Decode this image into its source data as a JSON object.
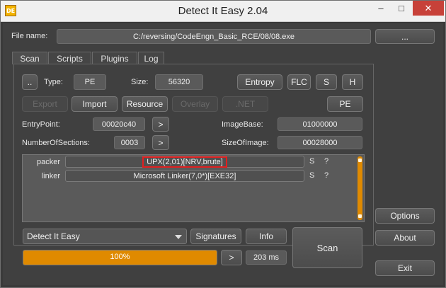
{
  "window": {
    "title": "Detect It Easy 2.04",
    "icon_text": "DE",
    "minimize": "–",
    "maximize": "□",
    "close": "✕"
  },
  "file": {
    "label": "File name:",
    "path": "C:/reversing/CodeEngn_Basic_RCE/08/08.exe",
    "browse": "..."
  },
  "tabs": [
    "Scan",
    "Scripts",
    "Plugins",
    "Log"
  ],
  "toolbar": {
    "dots": "..",
    "type_label": "Type:",
    "type_value": "PE",
    "size_label": "Size:",
    "size_value": "56320",
    "entropy": "Entropy",
    "flc": "FLC",
    "s": "S",
    "h": "H"
  },
  "row2": {
    "export": "Export",
    "import": "Import",
    "resource": "Resource",
    "overlay": "Overlay",
    "net": ".NET",
    "pe": "PE"
  },
  "info": {
    "entrypoint_label": "EntryPoint:",
    "entrypoint_value": "00020c40",
    "arrow": ">",
    "imagebase_label": "ImageBase:",
    "imagebase_value": "01000000",
    "sections_label": "NumberOfSections:",
    "sections_value": "0003",
    "sections_arrow": ">",
    "sizeofimage_label": "SizeOfImage:",
    "sizeofimage_value": "00028000"
  },
  "signatures": [
    {
      "type": "packer",
      "value": "UPX(2,01)[NRV,brute]",
      "s": "S",
      "q": "?"
    },
    {
      "type": "linker",
      "value": "Microsoft Linker(7,0*)[EXE32]",
      "s": "S",
      "q": "?"
    }
  ],
  "bottom": {
    "engine": "Detect It Easy",
    "signatures_btn": "Signatures",
    "info_btn": "Info",
    "scan_btn": "Scan",
    "progress_text": "100%",
    "progress": 1.0,
    "next": ">",
    "time": "203 ms"
  },
  "side": {
    "options": "Options",
    "about": "About",
    "exit": "Exit"
  }
}
